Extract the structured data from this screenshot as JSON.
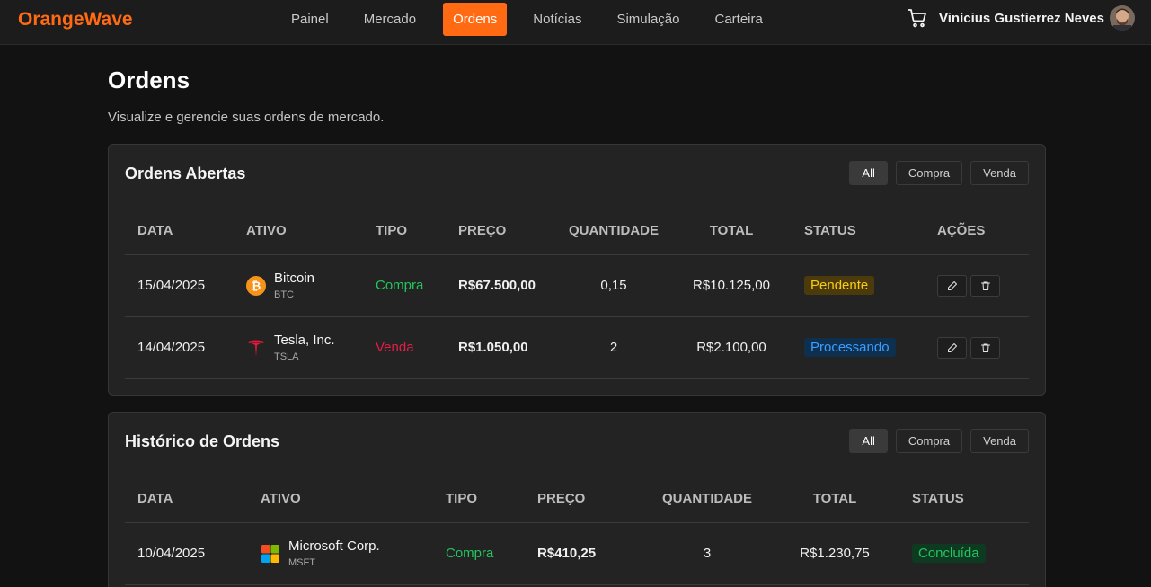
{
  "app": {
    "logo": "OrangeWave"
  },
  "nav": {
    "items": [
      {
        "label": "Painel",
        "active": false
      },
      {
        "label": "Mercado",
        "active": false
      },
      {
        "label": "Ordens",
        "active": true
      },
      {
        "label": "Notícias",
        "active": false
      },
      {
        "label": "Simulação",
        "active": false
      },
      {
        "label": "Carteira",
        "active": false
      }
    ],
    "user_name": "Vinícius Gustierrez Neves"
  },
  "page": {
    "title": "Ordens",
    "subtitle": "Visualize e gerencie suas ordens de mercado."
  },
  "filters": {
    "all": "All",
    "buy": "Compra",
    "sell": "Venda"
  },
  "open_orders": {
    "title": "Ordens Abertas",
    "headers": [
      "DATA",
      "ATIVO",
      "TIPO",
      "PREÇO",
      "QUANTIDADE",
      "TOTAL",
      "STATUS",
      "AÇÕES"
    ],
    "rows": [
      {
        "date": "15/04/2025",
        "asset": "Bitcoin",
        "ticker": "BTC",
        "icon": "bitcoin-icon",
        "type": "Compra",
        "price": "R$67.500,00",
        "quantity": "0,15",
        "total": "R$10.125,00",
        "status": "Pendente"
      },
      {
        "date": "14/04/2025",
        "asset": "Tesla, Inc.",
        "ticker": "TSLA",
        "icon": "tesla-icon",
        "type": "Venda",
        "price": "R$1.050,00",
        "quantity": "2",
        "total": "R$2.100,00",
        "status": "Processando"
      }
    ]
  },
  "history": {
    "title": "Histórico de Ordens",
    "headers": [
      "DATA",
      "ATIVO",
      "TIPO",
      "PREÇO",
      "QUANTIDADE",
      "TOTAL",
      "STATUS"
    ],
    "rows": [
      {
        "date": "10/04/2025",
        "asset": "Microsoft Corp.",
        "ticker": "MSFT",
        "icon": "microsoft-icon",
        "type": "Compra",
        "price": "R$410,25",
        "quantity": "3",
        "total": "R$1.230,75",
        "status": "Concluída"
      }
    ]
  },
  "colors": {
    "accent": "#ff6a13",
    "buy": "#22c55e",
    "sell": "#e11d48",
    "pending": "#facc15",
    "processing": "#3b9eff"
  }
}
